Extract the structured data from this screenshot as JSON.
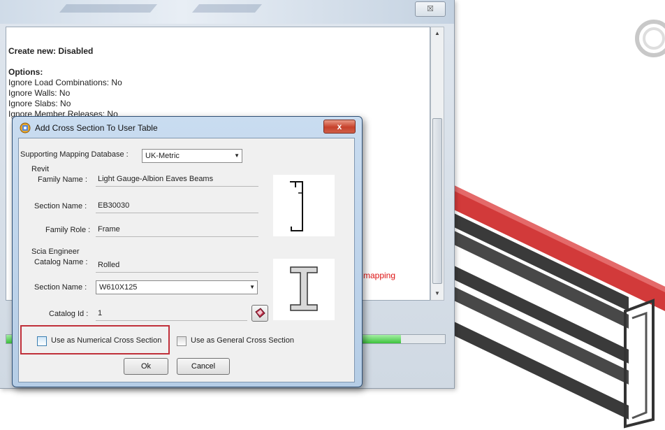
{
  "background_window": {
    "close_label": "☒",
    "log_lines": [
      {
        "text": "Create new: Disabled",
        "style": "bold"
      },
      {
        "text": "Options:",
        "style": "bold"
      },
      {
        "text": "Ignore Load Combinations: No",
        "style": "normal"
      },
      {
        "text": "Ignore Walls: No",
        "style": "normal"
      },
      {
        "text": "Ignore Slabs: No",
        "style": "normal"
      },
      {
        "text": "Ignore Member Releases: No",
        "style": "normal"
      }
    ],
    "side_text": "mapping",
    "progress_fraction": 0.9
  },
  "dialog": {
    "title": "Add Cross Section To User Table",
    "close_label": "x",
    "mapping_db_label": "Supporting Mapping Database :",
    "mapping_db_value": "UK-Metric",
    "revit": {
      "group_label": "Revit",
      "family_name_label": "Family Name :",
      "family_name_value": "Light Gauge-Albion Eaves Beams",
      "section_name_label": "Section Name :",
      "section_name_value": "EB30030",
      "family_role_label": "Family Role :",
      "family_role_value": "Frame"
    },
    "scia": {
      "group_label": "Scia Engineer",
      "catalog_name_label": "Catalog Name :",
      "catalog_name_value": "Rolled",
      "section_name_label": "Section Name :",
      "section_name_value": "W610X125",
      "catalog_id_label": "Catalog Id :",
      "catalog_id_value": "1"
    },
    "numerical_checkbox_label": "Use as Numerical Cross Section",
    "general_checkbox_label": "Use as General Cross Section",
    "ok_label": "Ok",
    "cancel_label": "Cancel"
  },
  "colors": {
    "highlight": "#c0303a",
    "beam_red": "#d23a3a",
    "beam_dark": "#3a3a3a"
  },
  "icons": [
    "app-icon",
    "close-icon",
    "dropdown-arrow-icon",
    "catalog-book-icon",
    "channel-section-icon",
    "i-beam-section-icon",
    "rotate-icon"
  ]
}
